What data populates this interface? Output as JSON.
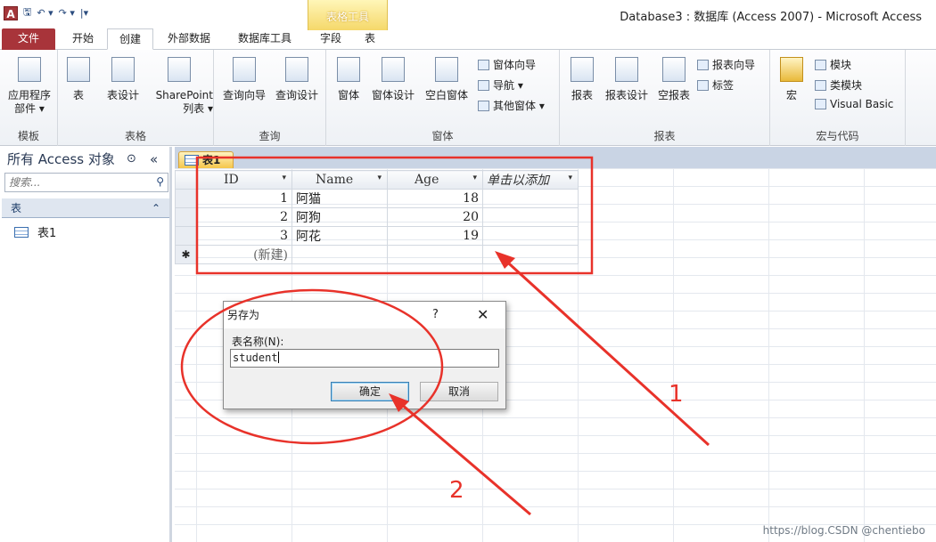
{
  "app": {
    "logo_letter": "A",
    "quick_access": [
      "🖫",
      "↶ ▾",
      "↷ ▾",
      "|▾"
    ],
    "context_tab": "表格工具",
    "window_title": "Database3 : 数据库 (Access 2007) - Microsoft Access"
  },
  "tabs": [
    {
      "label": "文件"
    },
    {
      "label": "开始"
    },
    {
      "label": "创建"
    },
    {
      "label": "外部数据"
    },
    {
      "label": "数据库工具"
    },
    {
      "label": "字段"
    },
    {
      "label": "表"
    }
  ],
  "ribbon": {
    "templates": {
      "group": "模板",
      "app_parts": "应用程序\n部件 ▾"
    },
    "tables": {
      "group": "表格",
      "table": "表",
      "table_design": "表设计",
      "sharepoint": "SharePoint\n列表 ▾"
    },
    "queries": {
      "group": "查询",
      "wizard": "查询向导",
      "design": "查询设计"
    },
    "forms": {
      "group": "窗体",
      "form": "窗体",
      "form_design": "窗体设计",
      "blank_form": "空白窗体",
      "form_wizard": "窗体向导",
      "navigation": "导航 ▾",
      "more_forms": "其他窗体 ▾"
    },
    "reports": {
      "group": "报表",
      "report": "报表",
      "report_design": "报表设计",
      "blank_report": "空报表",
      "report_wizard": "报表向导",
      "labels": "标签"
    },
    "macros": {
      "group": "宏与代码",
      "macro": "宏",
      "module": "模块",
      "class_module": "类模块",
      "vba": "Visual Basic"
    }
  },
  "nav": {
    "header": "所有 Access 对象",
    "header_btn": "⊙",
    "collapse": "«",
    "search_placeholder": "搜索...",
    "group_label": "表",
    "group_toggle": "⌃",
    "items": [
      {
        "label": "表1"
      }
    ]
  },
  "document": {
    "tab_label": "表1",
    "columns": [
      "ID",
      "Name",
      "Age",
      "单击以添加"
    ],
    "rows": [
      {
        "id": "1",
        "name": "阿猫",
        "age": "18"
      },
      {
        "id": "2",
        "name": "阿狗",
        "age": "20"
      },
      {
        "id": "3",
        "name": "阿花",
        "age": "19"
      }
    ],
    "new_row_marker": "✱",
    "new_row_label": "(新建)"
  },
  "dialog": {
    "title": "另存为",
    "help": "?",
    "close": "✕",
    "field_label": "表名称(N):",
    "value": "student",
    "ok": "确定",
    "cancel": "取消"
  },
  "annotations": {
    "step1": "1",
    "step2": "2",
    "color": "#e8322a"
  },
  "watermark": "https://blog.CSDN @chentiebo"
}
